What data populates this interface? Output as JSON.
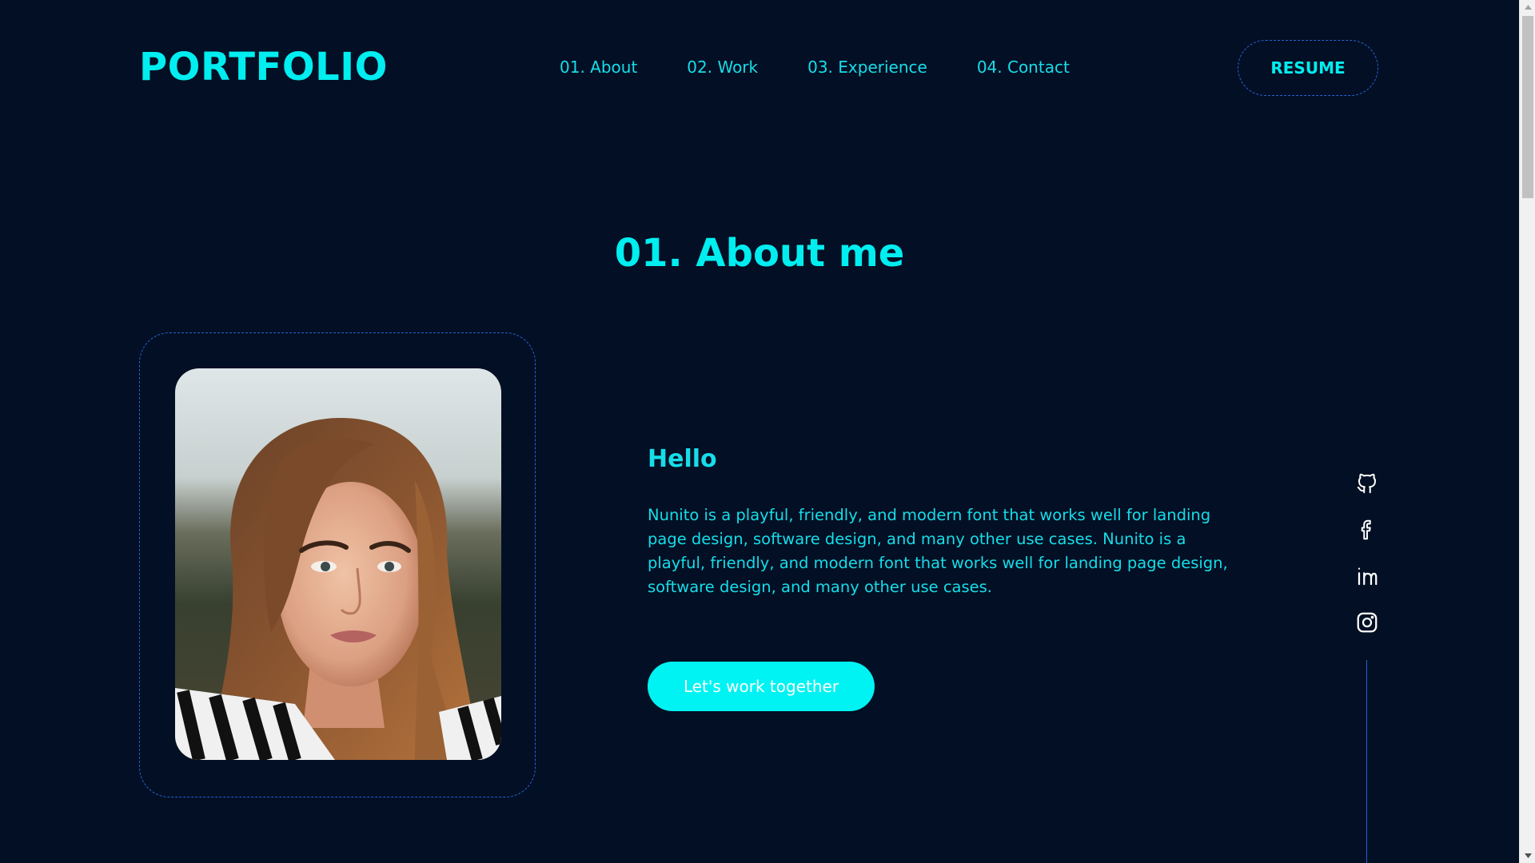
{
  "header": {
    "logo": "PORTFOLIO",
    "nav": [
      {
        "label": "01. About"
      },
      {
        "label": "02. Work"
      },
      {
        "label": "03. Experience"
      },
      {
        "label": "04. Contact"
      }
    ],
    "resume_label": "RESUME"
  },
  "about": {
    "title": "01. About me",
    "greeting": "Hello",
    "bio": "Nunito is a playful, friendly, and modern font that works well for landing page design, software design, and many other use cases. Nunito is a playful, friendly, and modern font that works well for landing page design, software design, and many other use cases.",
    "cta_label": "Let's work together"
  },
  "social": [
    {
      "icon": "github-icon"
    },
    {
      "icon": "facebook-icon"
    },
    {
      "icon": "linkedin-icon"
    },
    {
      "icon": "instagram-icon"
    }
  ],
  "colors": {
    "background": "#030f24",
    "accent": "#00eef0",
    "border": "#2463d6",
    "button_fill": "#00f3f3",
    "button_text": "#ffffff"
  }
}
